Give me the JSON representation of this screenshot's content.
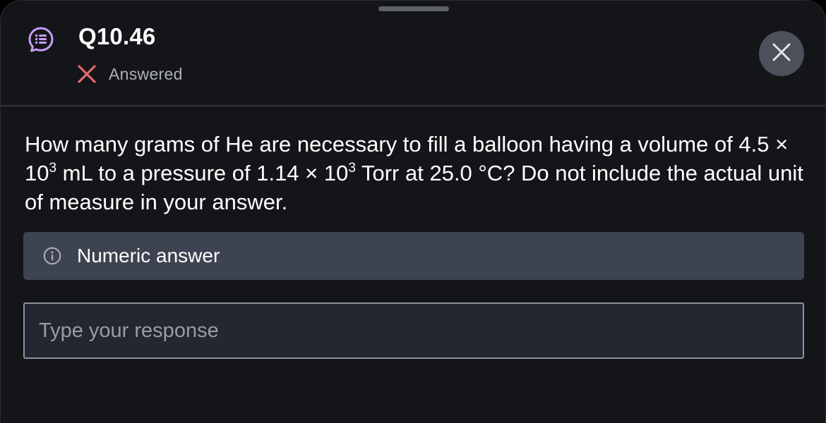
{
  "header": {
    "title": "Q10.46",
    "icon": "chat-list-icon",
    "status_icon": "x-mark-icon",
    "status_label": "Answered",
    "status_color": "#e06c6c",
    "accent_color": "#c79ef5",
    "close_icon": "close-icon"
  },
  "question": {
    "part1": "How many grams of He are necessary to fill a balloon having a volume of 4.5 × 10",
    "exp1": "3",
    "part2": " mL to a pressure of 1.14 × 10",
    "exp2": "3",
    "part3": " Torr at 25.0 °C? Do not include the actual unit of measure in your answer."
  },
  "answer_type": {
    "icon": "info-icon",
    "label": "Numeric answer"
  },
  "response": {
    "placeholder": "Type your response",
    "value": ""
  }
}
